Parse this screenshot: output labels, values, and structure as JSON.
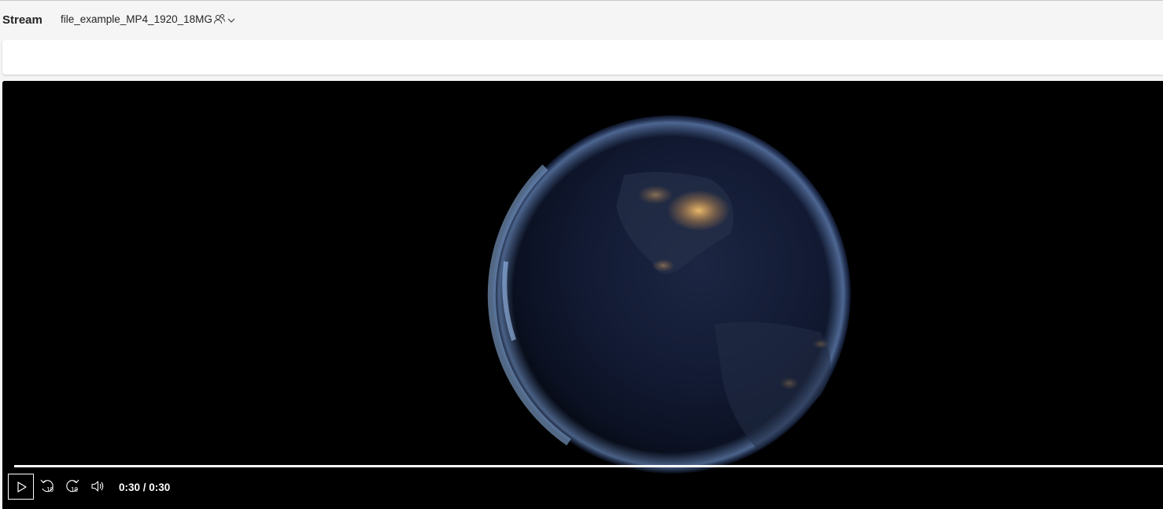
{
  "header": {
    "app_name": "Stream",
    "file_name": "file_example_MP4_1920_18MG",
    "share_icon": "people-icon",
    "dropdown_icon": "chevron-down-icon"
  },
  "player": {
    "progress": 1.0,
    "time_display": "0:30 / 0:30",
    "controls": {
      "play": "play-icon",
      "rewind": "rewind-10-icon",
      "forward": "forward-10-icon",
      "volume": "volume-icon"
    },
    "rewind_label": "10",
    "forward_label": "10"
  },
  "colors": {
    "player_bg": "#000000",
    "page_bg": "#f5f5f5",
    "text": "#242424"
  }
}
